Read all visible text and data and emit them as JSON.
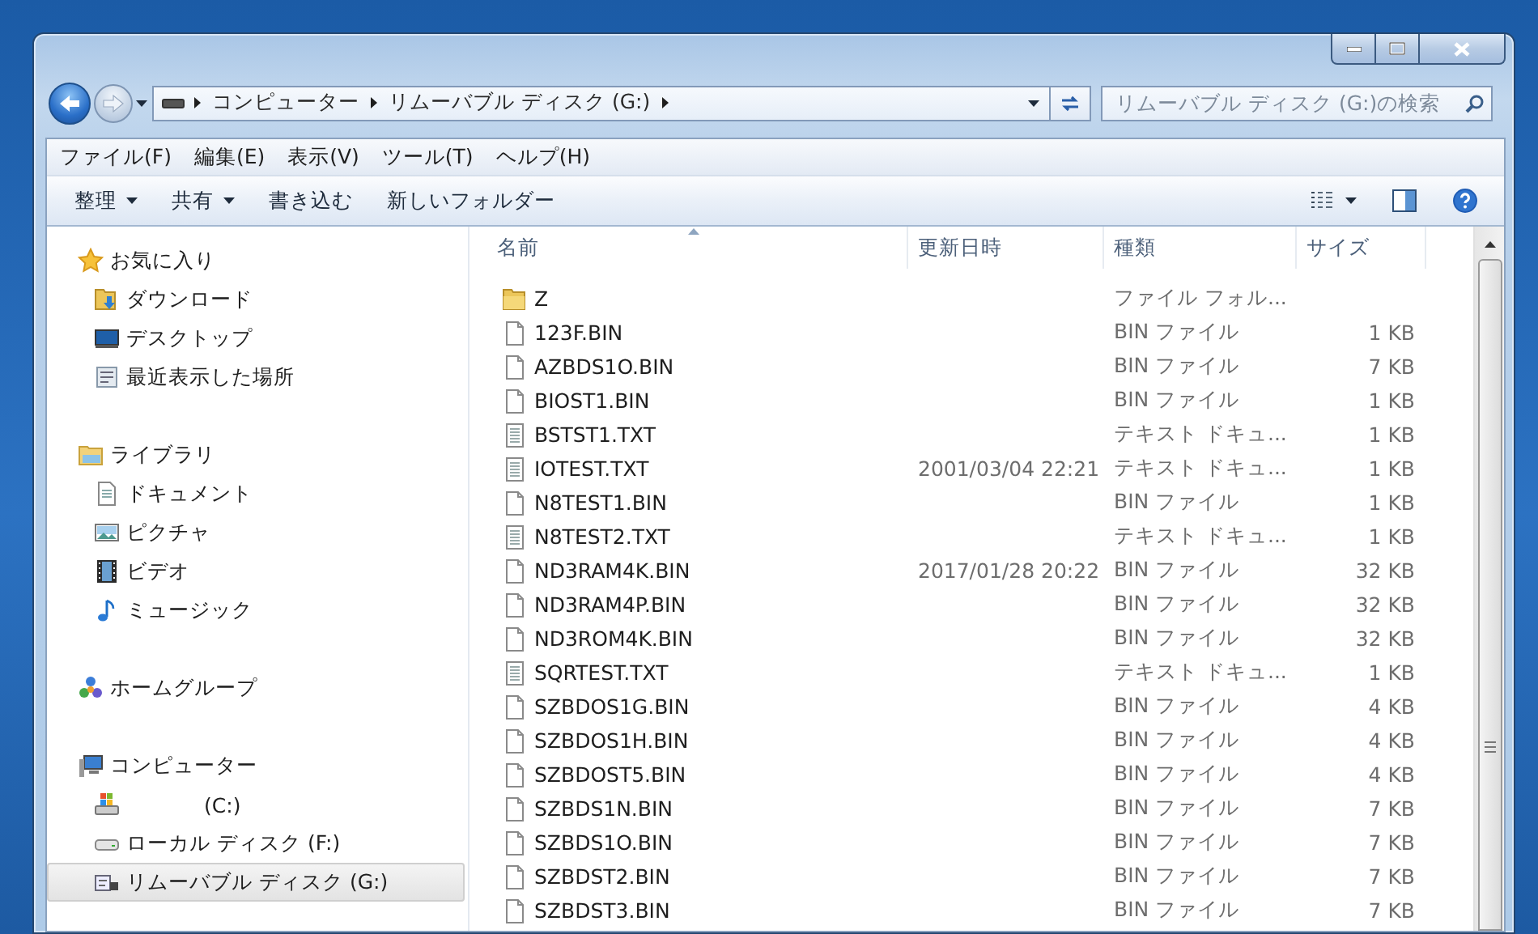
{
  "address_bar": {
    "segments": [
      "コンピューター",
      "リムーバブル ディスク (G:)"
    ]
  },
  "search": {
    "placeholder": "リムーバブル ディスク (G:)の検索"
  },
  "menu": [
    "ファイル(F)",
    "編集(E)",
    "表示(V)",
    "ツール(T)",
    "ヘルプ(H)"
  ],
  "toolbar": [
    {
      "label": "整理",
      "dropdown": true
    },
    {
      "label": "共有",
      "dropdown": true
    },
    {
      "label": "書き込む",
      "dropdown": false
    },
    {
      "label": "新しいフォルダー",
      "dropdown": false
    }
  ],
  "sidebar": {
    "groups": [
      {
        "label": "お気に入り",
        "kind": "favorites",
        "items": [
          {
            "label": "ダウンロード",
            "kind": "download",
            "selected": false
          },
          {
            "label": "デスクトップ",
            "kind": "desktop",
            "selected": false
          },
          {
            "label": "最近表示した場所",
            "kind": "recent",
            "selected": false
          }
        ]
      },
      {
        "label": "ライブラリ",
        "kind": "libraries",
        "items": [
          {
            "label": "ドキュメント",
            "kind": "documents",
            "selected": false
          },
          {
            "label": "ピクチャ",
            "kind": "pictures",
            "selected": false
          },
          {
            "label": "ビデオ",
            "kind": "videos",
            "selected": false
          },
          {
            "label": "ミュージック",
            "kind": "music",
            "selected": false
          }
        ]
      },
      {
        "label": "ホームグループ",
        "kind": "homegroup"
      },
      {
        "label": "コンピューター",
        "kind": "computer",
        "items": [
          {
            "label": "(C:)",
            "kind": "system-drive",
            "selected": false
          },
          {
            "label": "ローカル ディスク (F:)",
            "kind": "local-drive",
            "selected": false
          },
          {
            "label": "リムーバブル ディスク (G:)",
            "kind": "removable-drive",
            "selected": true
          }
        ]
      }
    ]
  },
  "file_list": {
    "columns": [
      {
        "label": "名前",
        "sorted": true
      },
      {
        "label": "更新日時",
        "sorted": false
      },
      {
        "label": "種類",
        "sorted": false
      },
      {
        "label": "サイズ",
        "sorted": false
      }
    ],
    "rows": [
      {
        "kind": "folder",
        "name": "Z",
        "type": "ファイル フォル..."
      },
      {
        "kind": "bin",
        "name": "123F.BIN",
        "type": "BIN ファイル",
        "size": "1 KB"
      },
      {
        "kind": "bin",
        "name": "AZBDS1O.BIN",
        "type": "BIN ファイル",
        "size": "7 KB"
      },
      {
        "kind": "bin",
        "name": "BIOST1.BIN",
        "type": "BIN ファイル",
        "size": "1 KB"
      },
      {
        "kind": "text",
        "name": "BSTST1.TXT",
        "type": "テキスト ドキュ...",
        "size": "1 KB"
      },
      {
        "kind": "text",
        "name": "IOTEST.TXT",
        "date": "2001/03/04 22:21",
        "type": "テキスト ドキュ...",
        "size": "1 KB"
      },
      {
        "kind": "bin",
        "name": "N8TEST1.BIN",
        "type": "BIN ファイル",
        "size": "1 KB"
      },
      {
        "kind": "text",
        "name": "N8TEST2.TXT",
        "type": "テキスト ドキュ...",
        "size": "1 KB"
      },
      {
        "kind": "bin",
        "name": "ND3RAM4K.BIN",
        "date": "2017/01/28 20:22",
        "type": "BIN ファイル",
        "size": "32 KB"
      },
      {
        "kind": "bin",
        "name": "ND3RAM4P.BIN",
        "type": "BIN ファイル",
        "size": "32 KB"
      },
      {
        "kind": "bin",
        "name": "ND3ROM4K.BIN",
        "type": "BIN ファイル",
        "size": "32 KB"
      },
      {
        "kind": "text",
        "name": "SQRTEST.TXT",
        "type": "テキスト ドキュ...",
        "size": "1 KB"
      },
      {
        "kind": "bin",
        "name": "SZBDOS1G.BIN",
        "type": "BIN ファイル",
        "size": "4 KB"
      },
      {
        "kind": "bin",
        "name": "SZBDOS1H.BIN",
        "type": "BIN ファイル",
        "size": "4 KB"
      },
      {
        "kind": "bin",
        "name": "SZBDOST5.BIN",
        "type": "BIN ファイル",
        "size": "4 KB"
      },
      {
        "kind": "bin",
        "name": "SZBDS1N.BIN",
        "type": "BIN ファイル",
        "size": "7 KB"
      },
      {
        "kind": "bin",
        "name": "SZBDS1O.BIN",
        "type": "BIN ファイル",
        "size": "7 KB"
      },
      {
        "kind": "bin",
        "name": "SZBDST2.BIN",
        "type": "BIN ファイル",
        "size": "7 KB"
      },
      {
        "kind": "bin",
        "name": "SZBDST3.BIN",
        "type": "BIN ファイル",
        "size": "7 KB"
      }
    ]
  }
}
